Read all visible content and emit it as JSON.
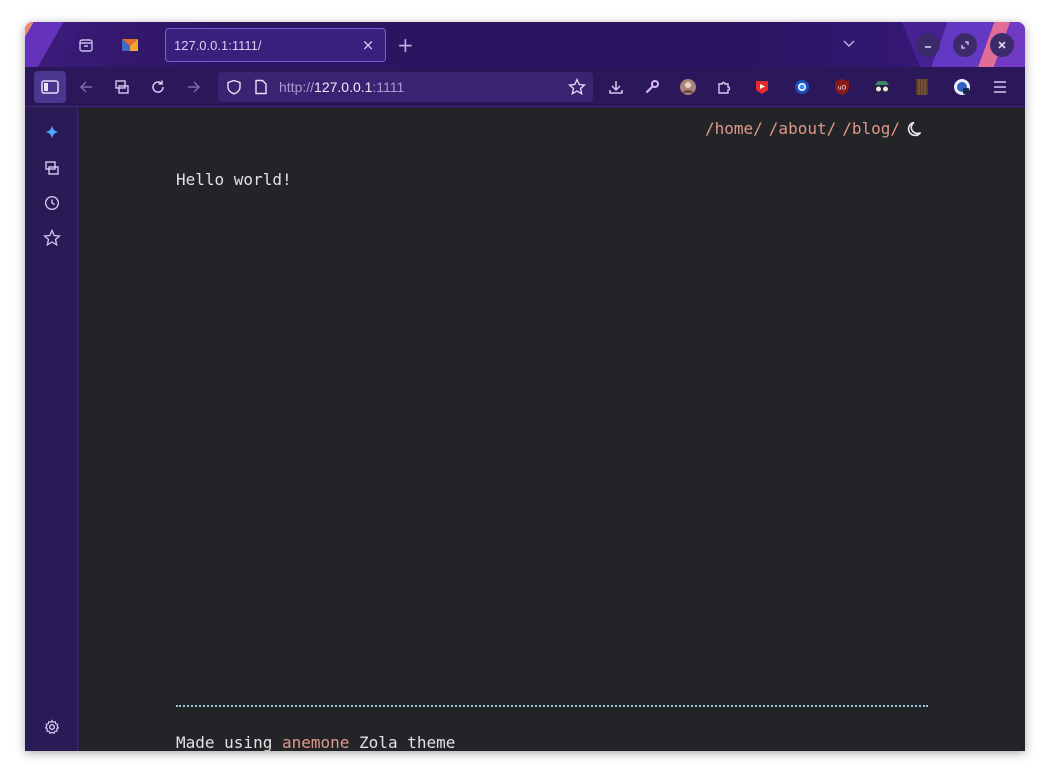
{
  "browser": {
    "tab": {
      "title": "127.0.0.1:1111/",
      "close": "×"
    },
    "new_tab": "+",
    "url": {
      "scheme": "http://",
      "host": "127.0.0.1",
      "port": ":1111"
    },
    "toolbar_icons": [
      "sidebar-toggle-icon",
      "back-arrow-icon",
      "tab-manager-icon",
      "reload-icon",
      "forward-arrow-icon",
      "shield-icon",
      "page-icon",
      "bookmark-star-icon",
      "download-icon",
      "wrench-icon",
      "profile-avatar-icon",
      "extensions-icon",
      "youtube-extension-icon",
      "blue-circle-extension-icon",
      "ublock-origin-icon",
      "spy-extension-icon",
      "bookshelf-extension-icon",
      "web-app-extension-icon",
      "menu-icon"
    ],
    "sidebar_icons": [
      "sparkle-icon",
      "tab-manager-icon",
      "history-clock-icon",
      "bookmark-star-icon",
      "settings-gear-icon"
    ],
    "colors": {
      "accent": "#7d5cd6",
      "chrome": "#2b1759",
      "page_bg": "#222428",
      "link": "#e0988a"
    }
  },
  "page": {
    "nav": [
      "/home/",
      "/about/",
      "/blog/"
    ],
    "theme_toggle_icon": "moon-icon",
    "body_text": "Hello world!",
    "footer": {
      "prefix": "Made using ",
      "link": "anemone",
      "suffix": " Zola theme"
    }
  }
}
